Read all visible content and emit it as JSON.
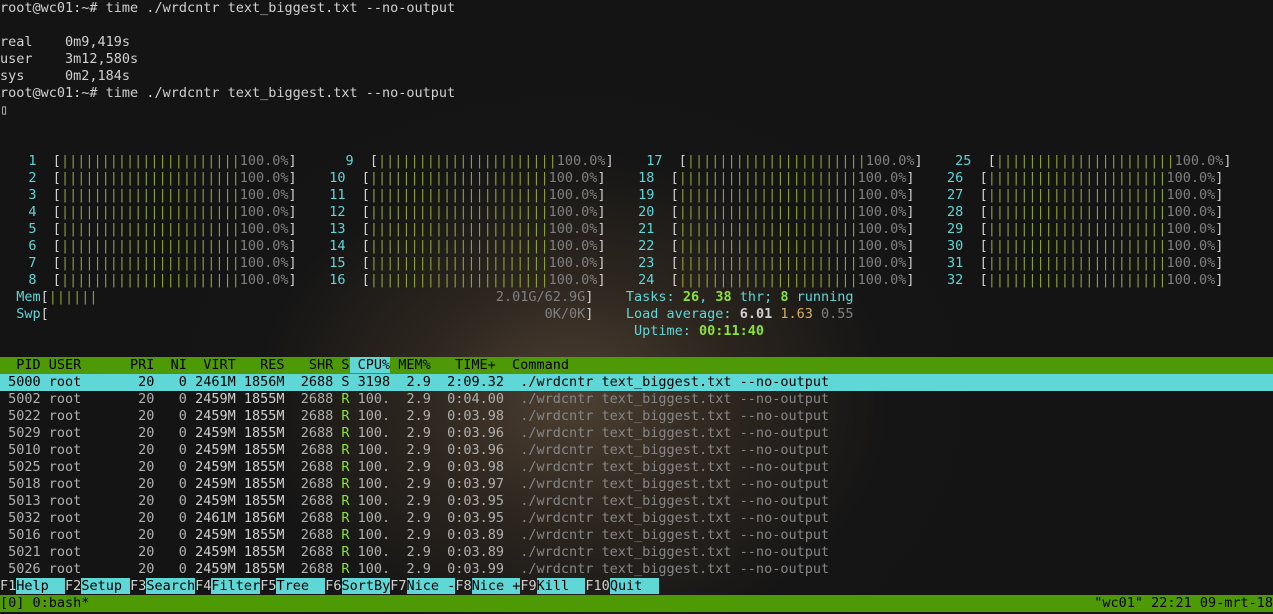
{
  "top": {
    "prompt1": "root@wc01:~# ",
    "cmd1": "time ./wrdcntr text_biggest.txt --no-output",
    "real_lbl": "real",
    "real_val": "0m9,419s",
    "user_lbl": "user",
    "user_val": "3m12,580s",
    "sys_lbl": "sys",
    "sys_val": "0m2,184s",
    "prompt2": "root@wc01:~# ",
    "cmd2": "time ./wrdcntr text_biggest.txt --no-output",
    "cursor": "▯"
  },
  "cpu_pct": "100.0%",
  "cpu_cols": [
    [
      "1",
      "2",
      "3",
      "4",
      "5",
      "6",
      "7",
      "8"
    ],
    [
      "9",
      "10",
      "11",
      "12",
      "13",
      "14",
      "15",
      "16"
    ],
    [
      "17",
      "18",
      "19",
      "20",
      "21",
      "22",
      "23",
      "24"
    ],
    [
      "25",
      "26",
      "27",
      "28",
      "29",
      "30",
      "31",
      "32"
    ]
  ],
  "mem": {
    "label": "Mem",
    "bar": "||||||",
    "value": "2.01G/62.9G"
  },
  "swp": {
    "label": "Swp",
    "value": "0K/0K"
  },
  "tasks": {
    "label": "Tasks: ",
    "count": "26",
    "sep": ", ",
    "thr_n": "38",
    "thr_l": " thr; ",
    "run_n": "8",
    "run_l": " running"
  },
  "load": {
    "label": "Load average: ",
    "v1": "6.01",
    "v2": "1.63",
    "v3": "0.55"
  },
  "uptime": {
    "label": "Uptime: ",
    "value": "00:11:40"
  },
  "headers": "  PID USER      PRI  NI  VIRT   RES   SHR S CPU% MEM%   TIME+  Command",
  "rows": [
    {
      "pid": "5000",
      "user": "root",
      "pri": "20",
      "ni": "0",
      "virt": "2461M",
      "res": "1856M",
      "shr": "2688",
      "s": "S",
      "cpu": "3198",
      "mem": "2.9",
      "time": "2:09.32",
      "cmd": "./wrdcntr text_biggest.txt --no-output"
    },
    {
      "pid": "5002",
      "user": "root",
      "pri": "20",
      "ni": "0",
      "virt": "2459M",
      "res": "1855M",
      "shr": "2688",
      "s": "R",
      "cpu": "100.",
      "mem": "2.9",
      "time": "0:04.00",
      "cmd": "./wrdcntr text_biggest.txt --no-output"
    },
    {
      "pid": "5022",
      "user": "root",
      "pri": "20",
      "ni": "0",
      "virt": "2459M",
      "res": "1855M",
      "shr": "2688",
      "s": "R",
      "cpu": "100.",
      "mem": "2.9",
      "time": "0:03.98",
      "cmd": "./wrdcntr text_biggest.txt --no-output"
    },
    {
      "pid": "5029",
      "user": "root",
      "pri": "20",
      "ni": "0",
      "virt": "2459M",
      "res": "1855M",
      "shr": "2688",
      "s": "R",
      "cpu": "100.",
      "mem": "2.9",
      "time": "0:03.96",
      "cmd": "./wrdcntr text_biggest.txt --no-output"
    },
    {
      "pid": "5010",
      "user": "root",
      "pri": "20",
      "ni": "0",
      "virt": "2459M",
      "res": "1855M",
      "shr": "2688",
      "s": "R",
      "cpu": "100.",
      "mem": "2.9",
      "time": "0:03.96",
      "cmd": "./wrdcntr text_biggest.txt --no-output"
    },
    {
      "pid": "5025",
      "user": "root",
      "pri": "20",
      "ni": "0",
      "virt": "2459M",
      "res": "1855M",
      "shr": "2688",
      "s": "R",
      "cpu": "100.",
      "mem": "2.9",
      "time": "0:03.98",
      "cmd": "./wrdcntr text_biggest.txt --no-output"
    },
    {
      "pid": "5018",
      "user": "root",
      "pri": "20",
      "ni": "0",
      "virt": "2459M",
      "res": "1855M",
      "shr": "2688",
      "s": "R",
      "cpu": "100.",
      "mem": "2.9",
      "time": "0:03.97",
      "cmd": "./wrdcntr text_biggest.txt --no-output"
    },
    {
      "pid": "5013",
      "user": "root",
      "pri": "20",
      "ni": "0",
      "virt": "2459M",
      "res": "1855M",
      "shr": "2688",
      "s": "R",
      "cpu": "100.",
      "mem": "2.9",
      "time": "0:03.95",
      "cmd": "./wrdcntr text_biggest.txt --no-output"
    },
    {
      "pid": "5032",
      "user": "root",
      "pri": "20",
      "ni": "0",
      "virt": "2461M",
      "res": "1856M",
      "shr": "2688",
      "s": "R",
      "cpu": "100.",
      "mem": "2.9",
      "time": "0:03.95",
      "cmd": "./wrdcntr text_biggest.txt --no-output"
    },
    {
      "pid": "5016",
      "user": "root",
      "pri": "20",
      "ni": "0",
      "virt": "2459M",
      "res": "1855M",
      "shr": "2688",
      "s": "R",
      "cpu": "100.",
      "mem": "2.9",
      "time": "0:03.89",
      "cmd": "./wrdcntr text_biggest.txt --no-output"
    },
    {
      "pid": "5021",
      "user": "root",
      "pri": "20",
      "ni": "0",
      "virt": "2459M",
      "res": "1855M",
      "shr": "2688",
      "s": "R",
      "cpu": "100.",
      "mem": "2.9",
      "time": "0:03.89",
      "cmd": "./wrdcntr text_biggest.txt --no-output"
    },
    {
      "pid": "5026",
      "user": "root",
      "pri": "20",
      "ni": "0",
      "virt": "2459M",
      "res": "1855M",
      "shr": "2688",
      "s": "R",
      "cpu": "100.",
      "mem": "2.9",
      "time": "0:03.99",
      "cmd": "./wrdcntr text_biggest.txt --no-output"
    }
  ],
  "fkeys": [
    {
      "f": "F1",
      "l": "Help  "
    },
    {
      "f": "F2",
      "l": "Setup "
    },
    {
      "f": "F3",
      "l": "Search"
    },
    {
      "f": "F4",
      "l": "Filter"
    },
    {
      "f": "F5",
      "l": "Tree  "
    },
    {
      "f": "F6",
      "l": "SortBy"
    },
    {
      "f": "F7",
      "l": "Nice -"
    },
    {
      "f": "F8",
      "l": "Nice +"
    },
    {
      "f": "F9",
      "l": "Kill  "
    },
    {
      "f": "F10",
      "l": "Quit  "
    }
  ],
  "status": {
    "left": "[0] 0:bash*",
    "right": "\"wc01\" 22:21 09-mrt-18"
  }
}
